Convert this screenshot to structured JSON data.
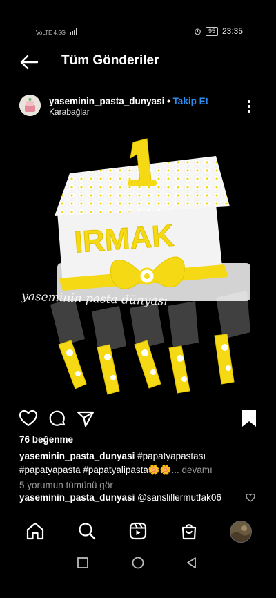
{
  "status_bar": {
    "network": "VoLTE 4.5G",
    "battery": "95",
    "time": "23:35"
  },
  "header": {
    "back_icon": "arrow-left-icon",
    "title": "Tüm Gönderiler"
  },
  "post": {
    "username": "yaseminin_pasta_dunyasi",
    "separator": " • ",
    "follow_label": "Takip Et",
    "location": "Karabağlar",
    "image_watermark": "yaseminin  pasta  dünyası",
    "cake_name": "IRMAK",
    "likes": "76 beğenme",
    "caption_user": "yaseminin_pasta_dunyasi",
    "caption_text_line1": " #papatyapastası",
    "caption_text_line2": "#papatyapasta #papatyalipasta🌼🌼",
    "caption_more": "... devamı",
    "view_comments": "5 yorumun tümünü gör",
    "comment_user": "yaseminin_pasta_dunyasi",
    "comment_text": " @sanslillermutfak06"
  },
  "colors": {
    "accent_blue": "#2f8ff0",
    "secondary_text": "#9a9a9a",
    "cake_yellow": "#f5d915"
  },
  "icons": {
    "actions": [
      "heart-icon",
      "comment-icon",
      "share-icon",
      "bookmark-icon"
    ],
    "bottom_nav": [
      "home-icon",
      "search-icon",
      "reels-icon",
      "shop-icon",
      "profile-avatar"
    ],
    "android_nav": [
      "recents-icon",
      "home-circle-icon",
      "back-triangle-icon"
    ]
  }
}
